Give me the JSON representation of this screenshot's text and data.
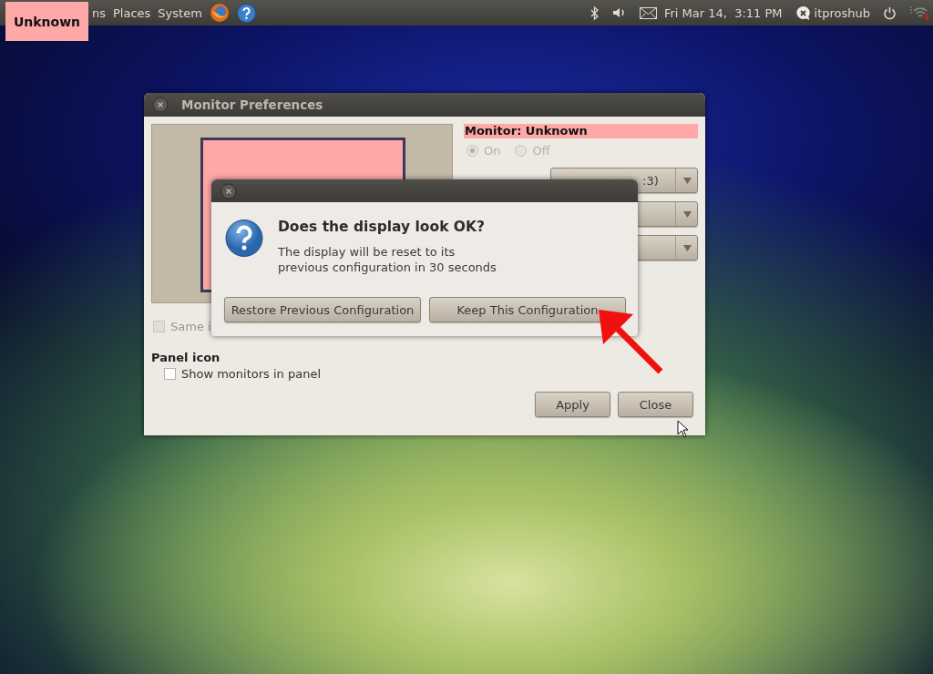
{
  "overlay_label": "Unknown",
  "top_panel": {
    "menus": [
      "ns",
      "Places",
      "System"
    ],
    "clock": "Fri Mar 14,  3:11 PM",
    "user": "itproshub"
  },
  "monitor_window": {
    "title": "Monitor Preferences",
    "monitor_label": "Monitor: Unknown",
    "power": [
      {
        "label": "On",
        "selected": true,
        "disabled": true
      },
      {
        "label": "Off",
        "selected": false,
        "disabled": true
      }
    ],
    "dropdowns": [
      {
        "kind": "text",
        "value": ":3)"
      },
      {
        "kind": "empty"
      },
      {
        "kind": "empty"
      }
    ],
    "same_image": {
      "label": "Same i",
      "checked": false,
      "disabled": true
    },
    "panel_icon": {
      "heading": "Panel icon",
      "label": "Show monitors in panel",
      "checked": false
    },
    "buttons": [
      "Apply",
      "Close"
    ]
  },
  "dialog": {
    "heading": "Does the display look OK?",
    "message": "The display will be reset to its\nprevious configuration in 30 seconds",
    "buttons": [
      "Restore Previous Configuration",
      "Keep This Configuration"
    ]
  }
}
